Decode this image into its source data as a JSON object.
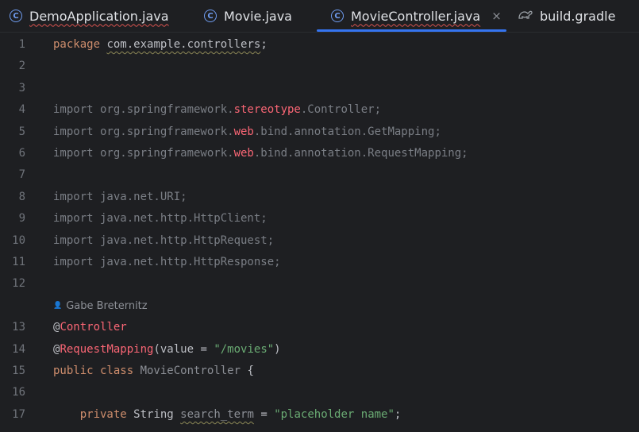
{
  "tabs": [
    {
      "label": "DemoApplication.java",
      "icon": "class-icon",
      "active": false
    },
    {
      "label": "Movie.java",
      "icon": "class-icon",
      "active": false
    },
    {
      "label": "MovieController.java",
      "icon": "class-icon",
      "active": true
    },
    {
      "label": "build.gradle",
      "icon": "gradle-icon",
      "active": false
    }
  ],
  "class_icon_glyph": "C",
  "close_glyph": "×",
  "author": "Gabe Breternitz",
  "lines": [
    {
      "n": "1",
      "parts": [
        [
          "kw",
          "package "
        ],
        [
          "wav",
          "com.example.controllers"
        ],
        [
          "plain",
          ";"
        ]
      ]
    },
    {
      "n": "2",
      "parts": []
    },
    {
      "n": "3",
      "parts": []
    },
    {
      "n": "4",
      "parts": [
        [
          "imp",
          "import org.springframework."
        ],
        [
          "red",
          "stereotype"
        ],
        [
          "imp",
          ".Controller;"
        ]
      ]
    },
    {
      "n": "5",
      "parts": [
        [
          "imp",
          "import org.springframework."
        ],
        [
          "red",
          "web"
        ],
        [
          "imp",
          ".bind.annotation.GetMapping;"
        ]
      ]
    },
    {
      "n": "6",
      "parts": [
        [
          "imp",
          "import org.springframework."
        ],
        [
          "red",
          "web"
        ],
        [
          "imp",
          ".bind.annotation.RequestMapping;"
        ]
      ]
    },
    {
      "n": "7",
      "parts": []
    },
    {
      "n": "8",
      "parts": [
        [
          "imp",
          "import java.net.URI;"
        ]
      ]
    },
    {
      "n": "9",
      "parts": [
        [
          "imp",
          "import java.net.http.HttpClient;"
        ]
      ]
    },
    {
      "n": "10",
      "parts": [
        [
          "imp",
          "import java.net.http.HttpRequest;"
        ]
      ]
    },
    {
      "n": "11",
      "parts": [
        [
          "imp",
          "import java.net.http.HttpResponse;"
        ]
      ]
    },
    {
      "n": "12",
      "parts": []
    },
    {
      "n": "13",
      "parts": [
        [
          "plain",
          "@"
        ],
        [
          "annot",
          "Controller"
        ]
      ]
    },
    {
      "n": "14",
      "parts": [
        [
          "plain",
          "@"
        ],
        [
          "annot",
          "RequestMapping"
        ],
        [
          "plain",
          "(value = "
        ],
        [
          "str",
          "\"/movies\""
        ],
        [
          "plain",
          ")"
        ]
      ]
    },
    {
      "n": "15",
      "parts": [
        [
          "kw",
          "public class "
        ],
        [
          "dim",
          "MovieController"
        ],
        [
          "plain",
          " {"
        ]
      ]
    },
    {
      "n": "16",
      "parts": []
    },
    {
      "n": "17",
      "parts": [
        [
          "plain",
          "    "
        ],
        [
          "kw",
          "private "
        ],
        [
          "plain",
          "String "
        ],
        [
          "dimwav",
          "search_term"
        ],
        [
          "plain",
          " = "
        ],
        [
          "str",
          "\"placeholder name\""
        ],
        [
          "plain",
          ";"
        ]
      ]
    }
  ]
}
